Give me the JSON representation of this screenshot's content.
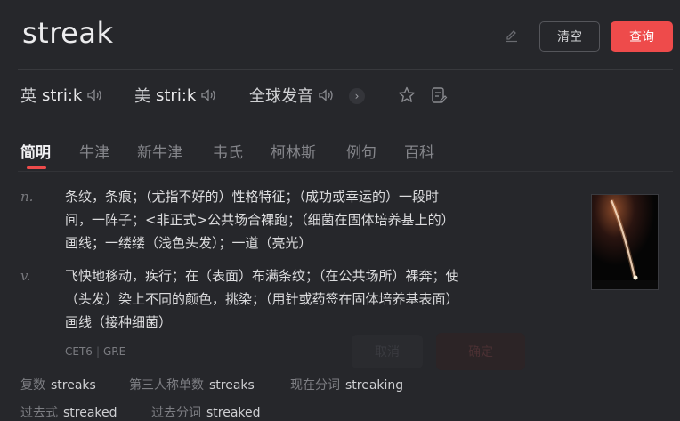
{
  "header": {
    "word": "streak",
    "clear_label": "清空",
    "search_label": "查询",
    "edit_icon": "pencil-icon"
  },
  "pronunciation": {
    "uk_label": "英",
    "uk_phonetic": "stri:k",
    "us_label": "美",
    "us_phonetic": "stri:k",
    "global_label": "全球发音",
    "speaker_icon": "speaker-icon",
    "more_icon": "chevron-right-icon",
    "favorite_icon": "star-icon",
    "note_icon": "note-edit-icon"
  },
  "tabs": [
    {
      "label": "简明",
      "active": true
    },
    {
      "label": "牛津",
      "active": false
    },
    {
      "label": "新牛津",
      "active": false
    },
    {
      "label": "韦氏",
      "active": false
    },
    {
      "label": "柯林斯",
      "active": false
    },
    {
      "label": "例句",
      "active": false
    },
    {
      "label": "百科",
      "active": false
    }
  ],
  "definitions": [
    {
      "pos": "n.",
      "lines": [
        "条纹，条痕；（尤指不好的）性格特征；（成功或幸运的）一段时",
        "间，一阵子；<非正式>公共场合裸跑；（细菌在固体培养基上的）",
        "画线；一缕缕（浅色头发）；一道（亮光）"
      ]
    },
    {
      "pos": "v.",
      "lines": [
        "飞快地移动，疾行；在（表面）布满条纹；（在公共场所）裸奔；使",
        "（头发）染上不同的颜色，挑染；（用针或药签在固体培养基表面）",
        "画线（接种细菌）"
      ]
    }
  ],
  "tags": [
    "CET6",
    "GRE"
  ],
  "ghost_buttons": [
    "取消",
    "确定"
  ],
  "forms": [
    {
      "label": "复数",
      "value": "streaks"
    },
    {
      "label": "第三人称单数",
      "value": "streaks"
    },
    {
      "label": "现在分词",
      "value": "streaking"
    },
    {
      "label": "过去式",
      "value": "streaked"
    },
    {
      "label": "过去分词",
      "value": "streaked"
    }
  ],
  "colors": {
    "accent": "#ee4b4b",
    "background": "#26272b"
  }
}
